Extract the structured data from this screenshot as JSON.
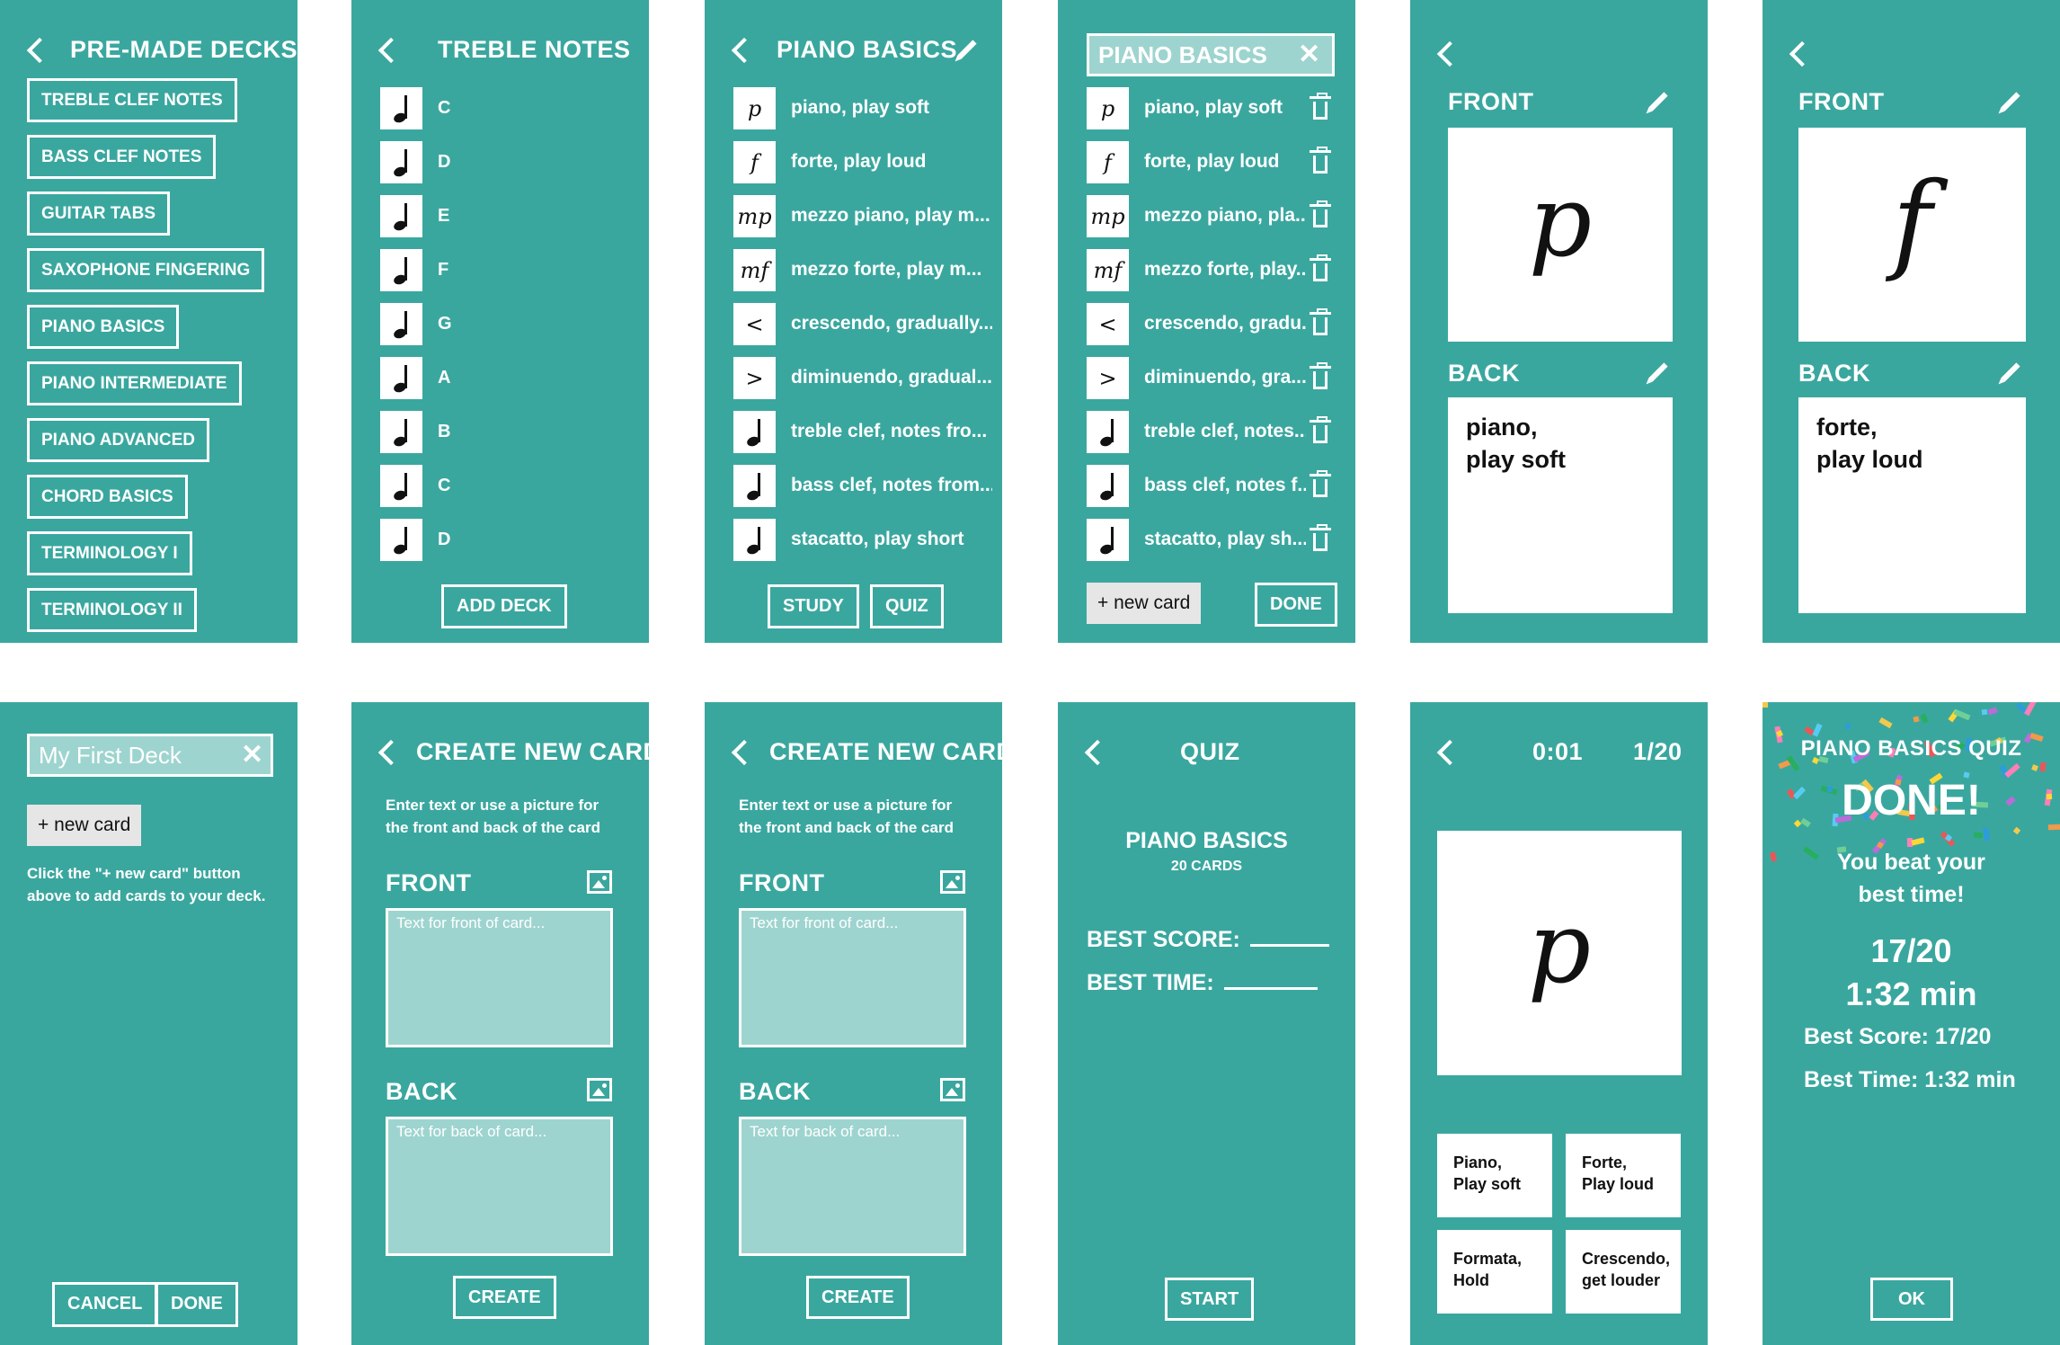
{
  "colors": {
    "teal": "#3aa79f",
    "light_teal": "#9ed4cf",
    "white": "#ffffff",
    "gray_button": "#e6e6e6"
  },
  "premade": {
    "title": "PRE-MADE DECKS",
    "decks": [
      "TREBLE CLEF NOTES",
      "BASS CLEF NOTES",
      "GUITAR TABS",
      "SAXOPHONE FINGERING",
      "PIANO BASICS",
      "PIANO INTERMEDIATE",
      "PIANO ADVANCED",
      "CHORD BASICS",
      "TERMINOLOGY I",
      "TERMINOLOGY II"
    ]
  },
  "treble": {
    "title": "TREBLE NOTES",
    "notes": [
      "C",
      "D",
      "E",
      "F",
      "G",
      "A",
      "B",
      "C",
      "D"
    ],
    "add_deck": "ADD DECK"
  },
  "basics": {
    "title": "PIANO BASICS",
    "cards": [
      {
        "symbol": "p",
        "icon": "",
        "text": "piano, play soft",
        "edit_text": "piano, play soft"
      },
      {
        "symbol": "f",
        "icon": "",
        "text": "forte, play loud",
        "edit_text": "forte, play loud"
      },
      {
        "symbol": "mp",
        "icon": "",
        "text": "mezzo piano, play m...",
        "edit_text": "mezzo piano, pla..."
      },
      {
        "symbol": "mf",
        "icon": "",
        "text": "mezzo forte, play m...",
        "edit_text": "mezzo forte, play..."
      },
      {
        "symbol": "<",
        "icon": "",
        "text": "crescendo, gradually...",
        "edit_text": "crescendo, gradu..."
      },
      {
        "symbol": ">",
        "icon": "",
        "text": "diminuendo, gradual...",
        "edit_text": "diminuendo, gra..."
      },
      {
        "symbol": "",
        "icon": "quarter-note-icon",
        "text": "treble clef, notes fro...",
        "edit_text": "treble clef, notes..."
      },
      {
        "symbol": "",
        "icon": "quarter-note-icon",
        "text": "bass clef, notes from...",
        "edit_text": "bass clef, notes f..."
      },
      {
        "symbol": "",
        "icon": "quarter-note-icon",
        "text": "stacatto, play short",
        "edit_text": "stacatto, play sh..."
      }
    ],
    "study": "STUDY",
    "quiz": "QUIZ"
  },
  "edit": {
    "title_value": "PIANO BASICS",
    "new_card": "+ new card",
    "done": "DONE"
  },
  "card1": {
    "front_label": "FRONT",
    "back_label": "BACK",
    "front_symbol": "p",
    "back_line1": "piano,",
    "back_line2": "play soft"
  },
  "card2": {
    "front_label": "FRONT",
    "back_label": "BACK",
    "front_symbol": "f",
    "back_line1": "forte,",
    "back_line2": "play loud"
  },
  "newdeck": {
    "title_value": "My First Deck",
    "new_card": "+ new card",
    "hint": "Click the \"+ new card\" button above to add cards to your deck.",
    "cancel": "CANCEL",
    "done": "DONE"
  },
  "create": {
    "title": "CREATE NEW CARD",
    "instructions": "Enter text or use a picture for the front and back of the card",
    "front_label": "FRONT",
    "back_label": "BACK",
    "front_placeholder": "Text for front of card...",
    "back_placeholder": "Text for back of card...",
    "create": "CREATE"
  },
  "quizstart": {
    "title": "QUIZ",
    "deck_name": "PIANO BASICS",
    "card_count": "20 CARDS",
    "best_score_label": "BEST SCORE:",
    "best_time_label": "BEST TIME:",
    "start": "START"
  },
  "quizplay": {
    "timer": "0:01",
    "progress": "1/20",
    "symbol": "p",
    "answers": [
      {
        "line1": "Piano,",
        "line2": "Play soft"
      },
      {
        "line1": "Forte,",
        "line2": "Play loud"
      },
      {
        "line1": "Formata,",
        "line2": "Hold"
      },
      {
        "line1": "Crescendo,",
        "line2": "get louder"
      }
    ]
  },
  "quizdone": {
    "title": "PIANO BASICS QUIZ",
    "done": "DONE!",
    "beat_line1": "You beat your",
    "beat_line2": "best time!",
    "score": "17/20",
    "time": "1:32 min",
    "best_score": "Best Score: 17/20",
    "best_time": "Best Time: 1:32 min",
    "ok": "OK"
  }
}
